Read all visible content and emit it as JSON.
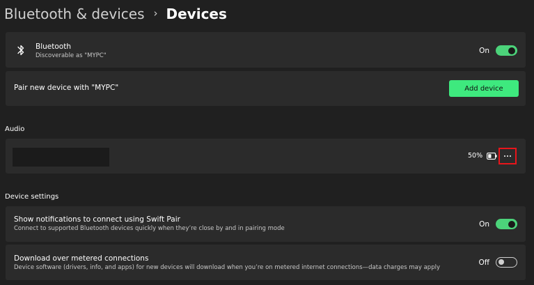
{
  "header": {
    "parent": "Bluetooth & devices",
    "separator_icon": "chevron-right-icon",
    "current": "Devices"
  },
  "bluetooth": {
    "icon": "bluetooth-icon",
    "title": "Bluetooth",
    "subtitle": "Discoverable as \"MYPC\"",
    "toggle_label": "On",
    "toggle_on": true
  },
  "pair": {
    "label": "Pair new device with \"MYPC\"",
    "button_label": "Add device"
  },
  "audio": {
    "section_title": "Audio",
    "device": {
      "battery_percent": "50%",
      "battery_icon": "battery-icon",
      "more_icon": "more-options-icon"
    }
  },
  "device_settings": {
    "section_title": "Device settings",
    "swift_pair": {
      "title": "Show notifications to connect using Swift Pair",
      "subtitle": "Connect to supported Bluetooth devices quickly when they’re close by and in pairing mode",
      "toggle_label": "On",
      "toggle_on": true
    },
    "metered": {
      "title": "Download over metered connections",
      "subtitle": "Device software (drivers, info, and apps) for new devices will download when you’re on metered internet connections—data charges may apply",
      "toggle_label": "Off",
      "toggle_on": false
    }
  },
  "colors": {
    "background": "#202020",
    "card": "#2b2b2b",
    "accent": "#4cd37a",
    "button": "#3ee97e",
    "highlight": "#e8151b"
  }
}
